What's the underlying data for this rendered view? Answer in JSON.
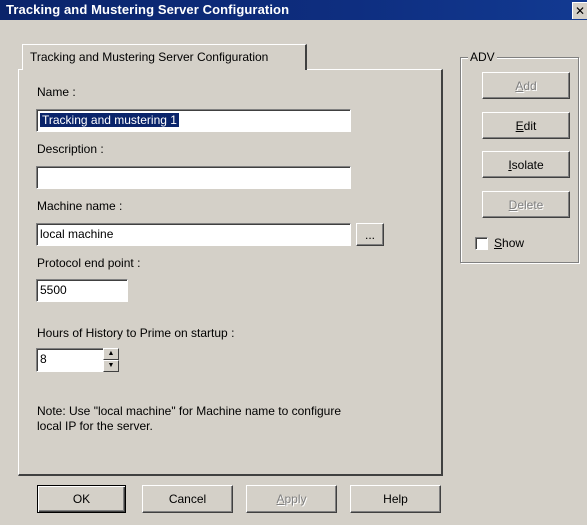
{
  "window": {
    "title": "Tracking and Mustering Server Configuration",
    "close_glyph": "✕"
  },
  "tab": {
    "label": "Tracking and Mustering Server Configuration"
  },
  "form": {
    "name_label": "Name :",
    "name_value": "Tracking and mustering 1",
    "description_label": "Description :",
    "description_value": "",
    "machine_label": "Machine name :",
    "machine_value": "local machine",
    "browse_label": "...",
    "protocol_label": "Protocol end point :",
    "protocol_value": "5500",
    "hours_label": "Hours of History to Prime on startup :",
    "hours_value": "8",
    "note_line1": "Note: Use \"local machine\" for Machine name to configure",
    "note_line2": "local IP for the server."
  },
  "adv": {
    "title": "ADV",
    "add": {
      "prefix": "",
      "key": "A",
      "rest": "dd"
    },
    "edit": {
      "prefix": "",
      "key": "E",
      "rest": "dit"
    },
    "isolate": {
      "prefix": "",
      "key": "I",
      "rest": "solate"
    },
    "delete": {
      "prefix": "",
      "key": "D",
      "rest": "elete"
    },
    "show": {
      "prefix": "",
      "key": "S",
      "rest": "how"
    },
    "show_checked": false
  },
  "footer": {
    "ok": "OK",
    "cancel": "Cancel",
    "apply": {
      "key": "A",
      "rest": "pply"
    },
    "help": "Help"
  }
}
